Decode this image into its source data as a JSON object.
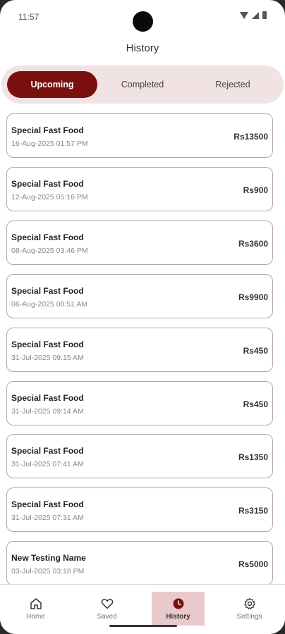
{
  "status_bar": {
    "time": "11:57"
  },
  "header": {
    "title": "History"
  },
  "tabs": [
    {
      "label": "Upcoming",
      "active": true
    },
    {
      "label": "Completed",
      "active": false
    },
    {
      "label": "Rejected",
      "active": false
    }
  ],
  "orders": [
    {
      "name": "Special Fast Food",
      "date": "16-Aug-2025 01:57 PM",
      "price": "Rs13500"
    },
    {
      "name": "Special Fast Food",
      "date": "12-Aug-2025 05:16 PM",
      "price": "Rs900"
    },
    {
      "name": "Special Fast Food",
      "date": "08-Aug-2025 03:46 PM",
      "price": "Rs3600"
    },
    {
      "name": "Special Fast Food",
      "date": "06-Aug-2025 08:51 AM",
      "price": "Rs9900"
    },
    {
      "name": "Special Fast Food",
      "date": "31-Jul-2025 09:15 AM",
      "price": "Rs450"
    },
    {
      "name": "Special Fast Food",
      "date": "31-Jul-2025 09:14 AM",
      "price": "Rs450"
    },
    {
      "name": "Special Fast Food",
      "date": "31-Jul-2025 07:41 AM",
      "price": "Rs1350"
    },
    {
      "name": "Special Fast Food",
      "date": "31-Jul-2025 07:31 AM",
      "price": "Rs3150"
    },
    {
      "name": "New Testing Name",
      "date": "03-Jul-2025 03:18 PM",
      "price": "Rs5000"
    }
  ],
  "bottom_nav": [
    {
      "label": "Home",
      "icon": "home-icon",
      "active": false
    },
    {
      "label": "Saved",
      "icon": "heart-icon",
      "active": false
    },
    {
      "label": "History",
      "icon": "clock-icon",
      "active": true
    },
    {
      "label": "Settings",
      "icon": "gear-icon",
      "active": false
    }
  ],
  "colors": {
    "accent": "#7a0f10",
    "tab_bg": "#f1e3e4",
    "nav_active": "#e9c9cb"
  }
}
